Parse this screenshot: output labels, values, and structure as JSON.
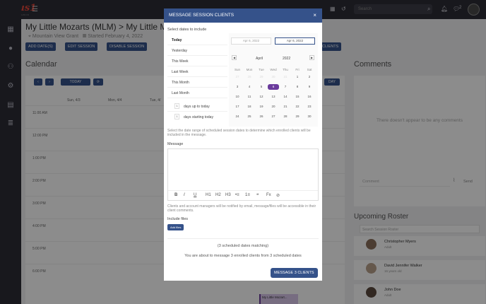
{
  "header": {
    "logo": "Opus1",
    "logo_sub": "MUSIC STUDIO",
    "search_placeholder": "Search",
    "notifications_count": "2"
  },
  "page": {
    "title": "My Little Mozarts (MLM) > My Little M",
    "location": "Mountain View Grant",
    "started": "Started February 4, 2022",
    "buttons": [
      "ADD DATE(S)",
      "EDIT SESSION",
      "DISABLE SESSION",
      "CLIENTS"
    ]
  },
  "calendar": {
    "title": "Calendar",
    "today_label": "TODAY",
    "day_label": "DAY",
    "day_headers": [
      "Sun, 4/3",
      "Mon, 4/4",
      "Tue, 4/"
    ],
    "hours": [
      "11:00 AM",
      "12:00 PM",
      "1:00 PM",
      "2:00 PM",
      "3:00 PM",
      "4:00 PM",
      "5:00 PM",
      "6:00 PM"
    ],
    "event_label": "My Little Mozart..."
  },
  "comments": {
    "title": "Comments",
    "empty": "There doesn't appear to be any comments",
    "placeholder": "Comment",
    "send": "Send"
  },
  "roster": {
    "title": "Upcoming Roster",
    "search_placeholder": "Search Session Roster",
    "people": [
      {
        "name": "Christopher Myers",
        "sub": "Adult"
      },
      {
        "name": "David Jennifer Walker",
        "sub": "16 years old"
      },
      {
        "name": "John Doe",
        "sub": "Adult"
      }
    ]
  },
  "modal": {
    "title": "MESSAGE SESSION CLIENTS",
    "select_label": "Select dates to include",
    "ranges": [
      "Today",
      "Yesterday",
      "This Week",
      "Last Week",
      "This Month",
      "Last Month"
    ],
    "days_up": "days up to today",
    "days_starting": "days starting today",
    "days_value": "1",
    "start_date": "Apr 6, 2022",
    "end_date": "Apr 6, 2022",
    "month": "April",
    "year": "2022",
    "dow": [
      "Sun",
      "Mon",
      "Tue",
      "Wed",
      "Thu",
      "Fri",
      "Sat"
    ],
    "range_hint": "Select the date range of scheduled session dates to determine which enrolled clients will be included in the message.",
    "message_label": "Message",
    "toolbar": [
      "B",
      "I",
      "U",
      "H1",
      "H2",
      "H3",
      "•≡",
      "1≡",
      "❝",
      "Fx",
      "⊘"
    ],
    "notify_hint": "Clients and account managers will be notified by email, message/files will be accessible in their client comments.",
    "include_files": "Include files",
    "add_files": "Add files",
    "matching": "(3 scheduled dates matching)",
    "summary": "You are about to message 3 enrolled clients from 3 scheduled dates",
    "send_button": "MESSAGE 3 CLIENTS"
  }
}
